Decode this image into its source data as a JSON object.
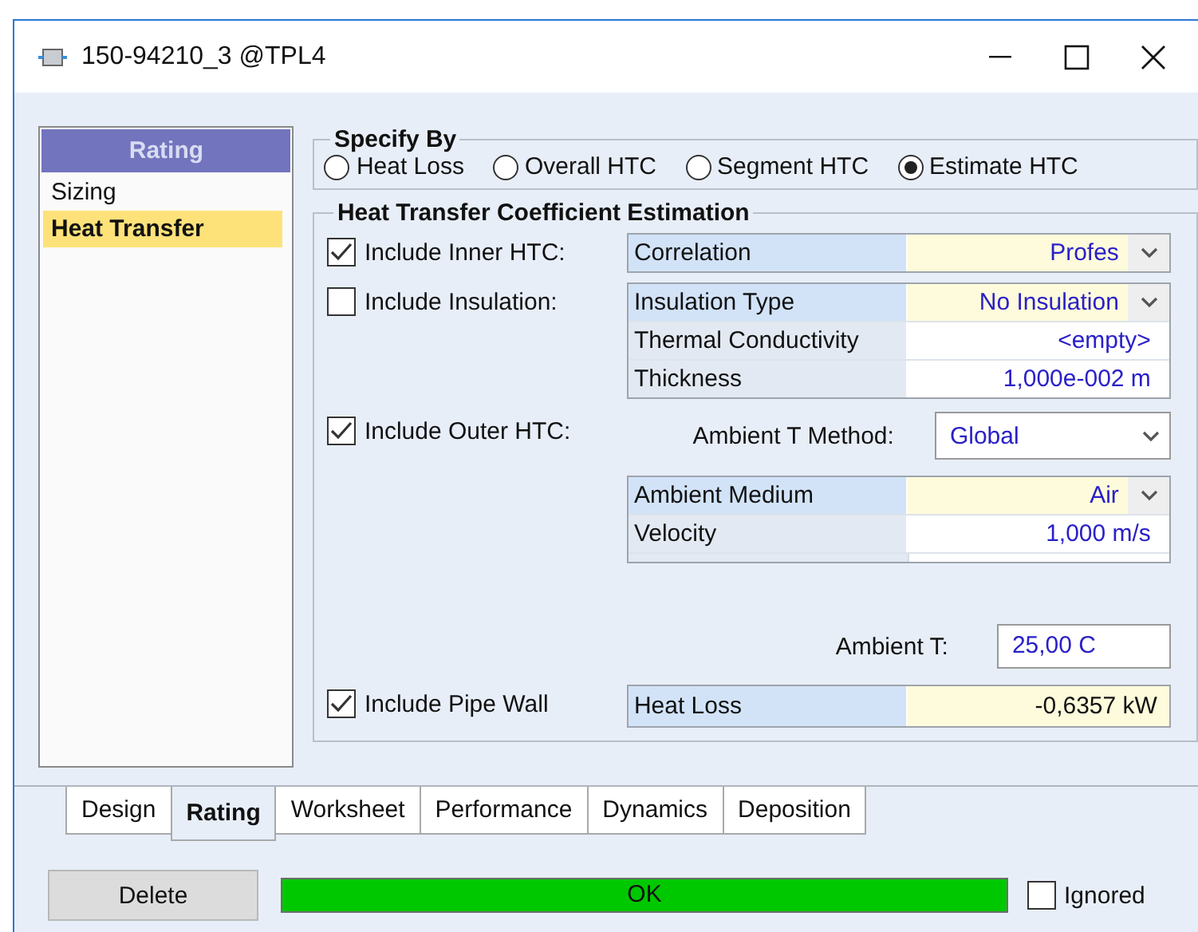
{
  "window": {
    "title": "150-94210_3 @TPL4"
  },
  "sidebar": {
    "header": "Rating",
    "items": [
      {
        "label": "Sizing",
        "selected": false
      },
      {
        "label": "Heat Transfer",
        "selected": true
      }
    ]
  },
  "specify_by": {
    "title": "Specify By",
    "options": [
      {
        "label": "Heat Loss",
        "selected": false
      },
      {
        "label": "Overall HTC",
        "selected": false
      },
      {
        "label": "Segment HTC",
        "selected": false
      },
      {
        "label": "Estimate HTC",
        "selected": true
      }
    ]
  },
  "htc_estimation": {
    "title": "Heat Transfer Coefficient Estimation",
    "sections": [
      {
        "checkbox": {
          "label": "Include Inner HTC:",
          "checked": true
        },
        "table": [
          {
            "kind": "dropdown",
            "label": "Correlation",
            "value": "Profes"
          }
        ]
      },
      {
        "checkbox": {
          "label": "Include Insulation:",
          "checked": false
        },
        "table": [
          {
            "kind": "dropdown",
            "label": "Insulation Type",
            "value": "No Insulation"
          },
          {
            "kind": "value",
            "label": "Thermal Conductivity",
            "value": "<empty>"
          },
          {
            "kind": "value",
            "label": "Thickness",
            "value": "1,000e-002 m"
          }
        ]
      },
      {
        "checkbox": {
          "label": "Include Outer HTC:",
          "checked": true
        },
        "select": {
          "label": "Ambient T Method:",
          "value": "Global"
        }
      },
      {
        "table": [
          {
            "kind": "dropdown",
            "label": "Ambient Medium",
            "value": "Air"
          },
          {
            "kind": "value",
            "label": "Velocity",
            "value": "1,000 m/s"
          },
          {
            "kind": "blank"
          }
        ]
      },
      {
        "field": {
          "label": "Ambient T:",
          "value": "25,00 C"
        }
      },
      {
        "checkbox": {
          "label": "Include Pipe Wall",
          "checked": true
        },
        "table": [
          {
            "kind": "result",
            "label": "Heat Loss",
            "value": "-0,6357 kW"
          }
        ]
      }
    ]
  },
  "tabs": [
    {
      "label": "Design",
      "selected": false
    },
    {
      "label": "Rating",
      "selected": true
    },
    {
      "label": "Worksheet",
      "selected": false
    },
    {
      "label": "Performance",
      "selected": false
    },
    {
      "label": "Dynamics",
      "selected": false
    },
    {
      "label": "Deposition",
      "selected": false
    }
  ],
  "footer": {
    "button": "Delete",
    "status": "OK",
    "ignored": {
      "label": "Ignored",
      "checked": false
    }
  }
}
